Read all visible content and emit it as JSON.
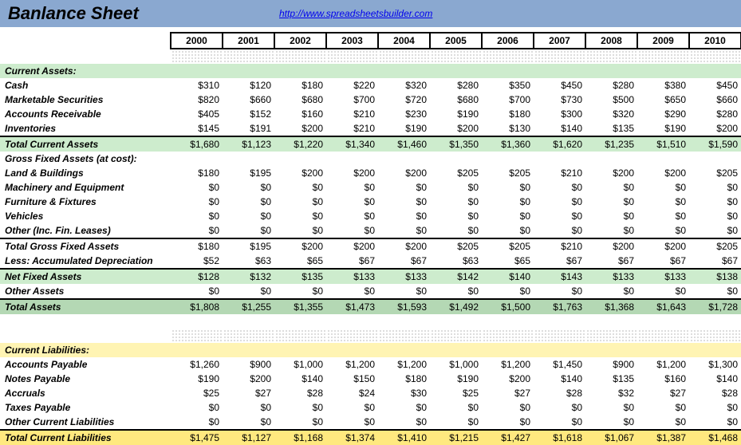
{
  "header": {
    "title": "Banlance Sheet",
    "link": "http://www.spreadsheetsbuilder.com"
  },
  "years": [
    "2000",
    "2001",
    "2002",
    "2003",
    "2004",
    "2005",
    "2006",
    "2007",
    "2008",
    "2009",
    "2010"
  ],
  "rows": [
    {
      "kind": "dots"
    },
    {
      "kind": "section",
      "label": "Current Assets:",
      "bg": "greenlight"
    },
    {
      "kind": "data",
      "label": "Cash",
      "vals": [
        "$310",
        "$120",
        "$180",
        "$220",
        "$320",
        "$280",
        "$350",
        "$450",
        "$280",
        "$380",
        "$450"
      ]
    },
    {
      "kind": "data",
      "label": "Marketable Securities",
      "vals": [
        "$820",
        "$660",
        "$680",
        "$700",
        "$720",
        "$680",
        "$700",
        "$730",
        "$500",
        "$650",
        "$660"
      ]
    },
    {
      "kind": "data",
      "label": "Accounts Receivable",
      "vals": [
        "$405",
        "$152",
        "$160",
        "$210",
        "$230",
        "$190",
        "$180",
        "$300",
        "$320",
        "$290",
        "$280"
      ]
    },
    {
      "kind": "data",
      "label": "Inventories",
      "vals": [
        "$145",
        "$191",
        "$200",
        "$210",
        "$190",
        "$200",
        "$130",
        "$140",
        "$135",
        "$190",
        "$200"
      ]
    },
    {
      "kind": "data",
      "label": "Total Current Assets",
      "bg": "greenlight",
      "bt": true,
      "vals": [
        "$1,680",
        "$1,123",
        "$1,220",
        "$1,340",
        "$1,460",
        "$1,350",
        "$1,360",
        "$1,620",
        "$1,235",
        "$1,510",
        "$1,590"
      ]
    },
    {
      "kind": "data",
      "label": "Gross Fixed Assets (at cost):",
      "noval": true
    },
    {
      "kind": "data",
      "label": "Land & Buildings",
      "vals": [
        "$180",
        "$195",
        "$200",
        "$200",
        "$200",
        "$205",
        "$205",
        "$210",
        "$200",
        "$200",
        "$205"
      ]
    },
    {
      "kind": "data",
      "label": "Machinery and Equipment",
      "vals": [
        "$0",
        "$0",
        "$0",
        "$0",
        "$0",
        "$0",
        "$0",
        "$0",
        "$0",
        "$0",
        "$0"
      ]
    },
    {
      "kind": "data",
      "label": "Furniture & Fixtures",
      "vals": [
        "$0",
        "$0",
        "$0",
        "$0",
        "$0",
        "$0",
        "$0",
        "$0",
        "$0",
        "$0",
        "$0"
      ]
    },
    {
      "kind": "data",
      "label": "Vehicles",
      "vals": [
        "$0",
        "$0",
        "$0",
        "$0",
        "$0",
        "$0",
        "$0",
        "$0",
        "$0",
        "$0",
        "$0"
      ]
    },
    {
      "kind": "data",
      "label": "Other (Inc. Fin. Leases)",
      "vals": [
        "$0",
        "$0",
        "$0",
        "$0",
        "$0",
        "$0",
        "$0",
        "$0",
        "$0",
        "$0",
        "$0"
      ]
    },
    {
      "kind": "data",
      "label": "Total Gross Fixed Assets",
      "bt": true,
      "vals": [
        "$180",
        "$195",
        "$200",
        "$200",
        "$200",
        "$205",
        "$205",
        "$210",
        "$200",
        "$200",
        "$205"
      ]
    },
    {
      "kind": "data",
      "label": "Less:  Accumulated Depreciation",
      "vals": [
        "$52",
        "$63",
        "$65",
        "$67",
        "$67",
        "$63",
        "$65",
        "$67",
        "$67",
        "$67",
        "$67"
      ]
    },
    {
      "kind": "data",
      "label": "Net Fixed Assets",
      "bg": "greenlight",
      "bt": true,
      "vals": [
        "$128",
        "$132",
        "$135",
        "$133",
        "$133",
        "$142",
        "$140",
        "$143",
        "$133",
        "$133",
        "$138"
      ]
    },
    {
      "kind": "data",
      "label": "Other Assets",
      "vals": [
        "$0",
        "$0",
        "$0",
        "$0",
        "$0",
        "$0",
        "$0",
        "$0",
        "$0",
        "$0",
        "$0"
      ]
    },
    {
      "kind": "data",
      "label": "Total Assets",
      "bg": "greenmed",
      "bt": true,
      "vals": [
        "$1,808",
        "$1,255",
        "$1,355",
        "$1,473",
        "$1,593",
        "$1,492",
        "$1,500",
        "$1,763",
        "$1,368",
        "$1,643",
        "$1,728"
      ]
    },
    {
      "kind": "blank"
    },
    {
      "kind": "dots"
    },
    {
      "kind": "section",
      "label": "Current Liabilities:",
      "bg": "yellowlight"
    },
    {
      "kind": "data",
      "label": "Accounts Payable",
      "vals": [
        "$1,260",
        "$900",
        "$1,000",
        "$1,200",
        "$1,200",
        "$1,000",
        "$1,200",
        "$1,450",
        "$900",
        "$1,200",
        "$1,300"
      ]
    },
    {
      "kind": "data",
      "label": "Notes Payable",
      "vals": [
        "$190",
        "$200",
        "$140",
        "$150",
        "$180",
        "$190",
        "$200",
        "$140",
        "$135",
        "$160",
        "$140"
      ]
    },
    {
      "kind": "data",
      "label": "Accruals",
      "vals": [
        "$25",
        "$27",
        "$28",
        "$24",
        "$30",
        "$25",
        "$27",
        "$28",
        "$32",
        "$27",
        "$28"
      ]
    },
    {
      "kind": "data",
      "label": "Taxes Payable",
      "vals": [
        "$0",
        "$0",
        "$0",
        "$0",
        "$0",
        "$0",
        "$0",
        "$0",
        "$0",
        "$0",
        "$0"
      ]
    },
    {
      "kind": "data",
      "label": "Other Current Liabilities",
      "vals": [
        "$0",
        "$0",
        "$0",
        "$0",
        "$0",
        "$0",
        "$0",
        "$0",
        "$0",
        "$0",
        "$0"
      ]
    },
    {
      "kind": "data",
      "label": "Total Current Liabilities",
      "bg": "yellowmed",
      "bt": true,
      "vals": [
        "$1,475",
        "$1,127",
        "$1,168",
        "$1,374",
        "$1,410",
        "$1,215",
        "$1,427",
        "$1,618",
        "$1,067",
        "$1,387",
        "$1,468"
      ]
    }
  ]
}
